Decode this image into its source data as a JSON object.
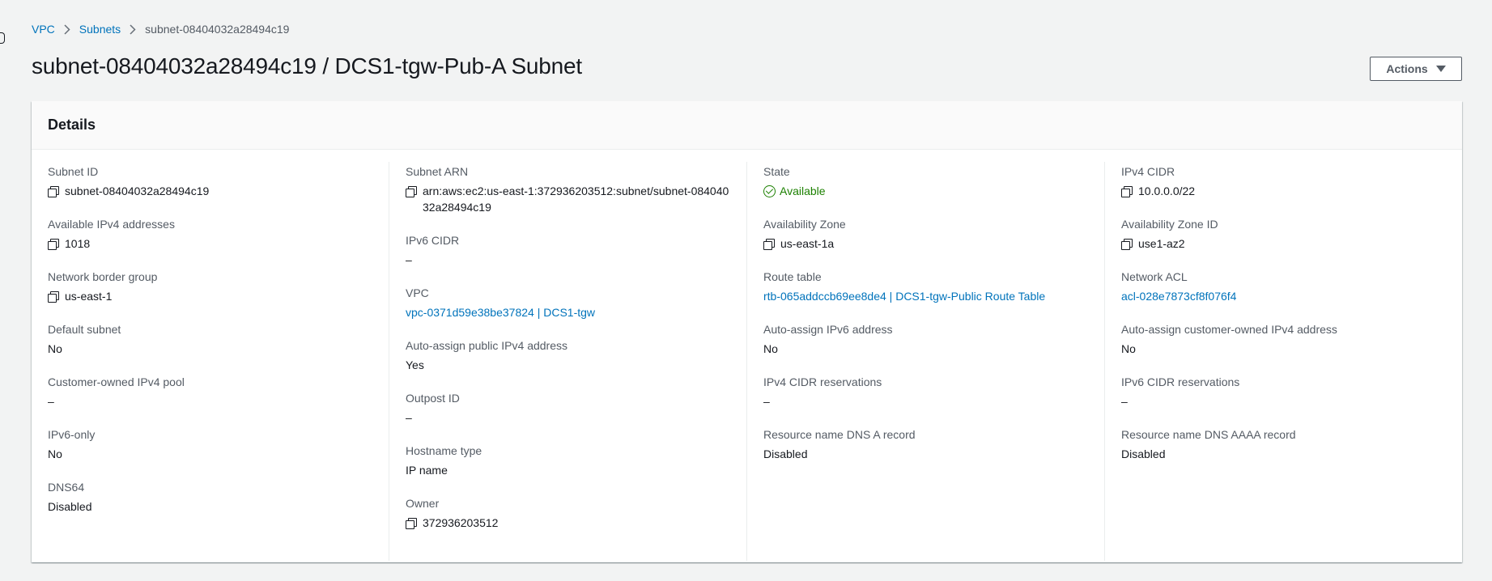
{
  "breadcrumb": {
    "items": [
      "VPC",
      "Subnets"
    ],
    "current": "subnet-08404032a28494c19"
  },
  "page": {
    "title": "subnet-08404032a28494c19 / DCS1-tgw-Pub-A Subnet",
    "actions_label": "Actions"
  },
  "details": {
    "title": "Details",
    "columns": [
      [
        {
          "label": "Subnet ID",
          "value": "subnet-08404032a28494c19",
          "copy": true
        },
        {
          "label": "Available IPv4 addresses",
          "value": "1018",
          "copy": true
        },
        {
          "label": "Network border group",
          "value": "us-east-1",
          "copy": true
        },
        {
          "label": "Default subnet",
          "value": "No"
        },
        {
          "label": "Customer-owned IPv4 pool",
          "value": "–"
        },
        {
          "label": "IPv6-only",
          "value": "No"
        },
        {
          "label": "DNS64",
          "value": "Disabled"
        }
      ],
      [
        {
          "label": "Subnet ARN",
          "value": "arn:aws:ec2:us-east-1:372936203512:subnet/subnet-08404032a28494c19",
          "copy": true
        },
        {
          "label": "IPv6 CIDR",
          "value": "–"
        },
        {
          "label": "VPC",
          "value": "vpc-0371d59e38be37824 | DCS1-tgw",
          "link": true
        },
        {
          "label": "Auto-assign public IPv4 address",
          "value": "Yes"
        },
        {
          "label": "Outpost ID",
          "value": "–"
        },
        {
          "label": "Hostname type",
          "value": "IP name"
        },
        {
          "label": "Owner",
          "value": "372936203512",
          "copy": true
        }
      ],
      [
        {
          "label": "State",
          "value": "Available",
          "status": true
        },
        {
          "label": "Availability Zone",
          "value": "us-east-1a",
          "copy": true
        },
        {
          "label": "Route table",
          "value": "rtb-065addccb69ee8de4 | DCS1-tgw-Public Route Table",
          "link": true
        },
        {
          "label": "Auto-assign IPv6 address",
          "value": "No"
        },
        {
          "label": "IPv4 CIDR reservations",
          "value": "–"
        },
        {
          "label": "Resource name DNS A record",
          "value": "Disabled"
        }
      ],
      [
        {
          "label": "IPv4 CIDR",
          "value": "10.0.0.0/22",
          "copy": true
        },
        {
          "label": "Availability Zone ID",
          "value": "use1-az2",
          "copy": true
        },
        {
          "label": "Network ACL",
          "value": "acl-028e7873cf8f076f4",
          "link": true
        },
        {
          "label": "Auto-assign customer-owned IPv4 address",
          "value": "No"
        },
        {
          "label": "IPv6 CIDR reservations",
          "value": "–"
        },
        {
          "label": "Resource name DNS AAAA record",
          "value": "Disabled"
        }
      ]
    ]
  },
  "colors": {
    "link": "#0073bb",
    "success": "#1d8102",
    "background": "#f2f3f3"
  },
  "icons": {
    "copy": "copy-icon",
    "status": "check-circle-icon",
    "separator": "chevron-right-icon",
    "dropdown": "caret-down-icon"
  }
}
